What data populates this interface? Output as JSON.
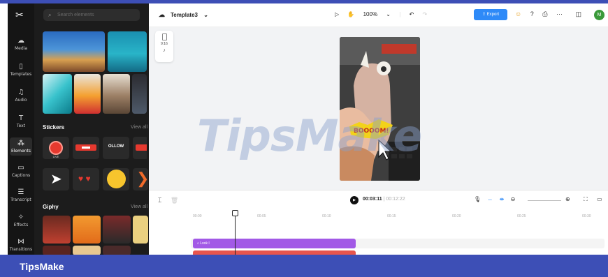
{
  "rail": {
    "logo": "✂",
    "items": [
      {
        "label": "Media",
        "icon": "cloud-icon"
      },
      {
        "label": "Templates",
        "icon": "templates-icon"
      },
      {
        "label": "Audio",
        "icon": "music-icon"
      },
      {
        "label": "Text",
        "icon": "text-icon"
      },
      {
        "label": "Elements",
        "icon": "elements-icon",
        "active": true
      },
      {
        "label": "Captions",
        "icon": "captions-icon"
      },
      {
        "label": "Transcript",
        "icon": "transcript-icon"
      },
      {
        "label": "Effects",
        "icon": "effects-icon"
      },
      {
        "label": "Transitions",
        "icon": "transitions-icon"
      }
    ]
  },
  "panel": {
    "search_placeholder": "Search elements",
    "stickers_title": "Stickers",
    "view_all": "View all",
    "giphy_title": "Giphy",
    "giphy_view_all": "View all",
    "sticker_follow": "OLLOW",
    "sticker_live": "LIVE"
  },
  "topbar": {
    "project_name": "Template3",
    "zoom": "100%",
    "export_label": "Export",
    "avatar_letter": "M"
  },
  "canvas": {
    "ratio_label": "9:16",
    "sticker_text": "BOOOOM!"
  },
  "watermark": "TipsMake",
  "timeline": {
    "current_time": "00:03:11",
    "duration": "00:12:22",
    "ruler": [
      "00:00",
      "00:05",
      "00:10",
      "00:15",
      "00:20",
      "00:25",
      "00:30"
    ],
    "clip_label": "Look I"
  },
  "banner": {
    "text": "TipsMake"
  },
  "colors": {
    "brand_blue": "#3d4fb6",
    "export_blue": "#2e8af8",
    "clip_purple": "#a259e6",
    "clip_red": "#e8554d"
  }
}
